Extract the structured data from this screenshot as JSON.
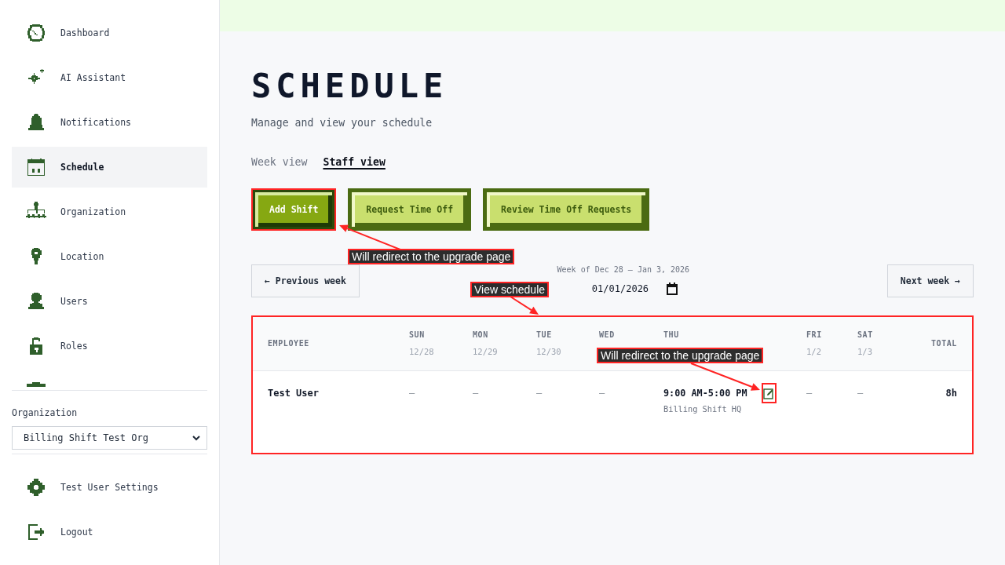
{
  "sidebar": {
    "nav_items": [
      {
        "label": "Dashboard",
        "selected": false
      },
      {
        "label": "AI Assistant",
        "selected": false
      },
      {
        "label": "Notifications",
        "selected": false
      },
      {
        "label": "Schedule",
        "selected": true
      },
      {
        "label": "Organization",
        "selected": false
      },
      {
        "label": "Location",
        "selected": false
      },
      {
        "label": "Users",
        "selected": false
      },
      {
        "label": "Roles",
        "selected": false
      }
    ],
    "organization": {
      "label": "Organization",
      "value": "Billing Shift Test Org"
    },
    "footer_items": [
      {
        "label": "Test User Settings"
      },
      {
        "label": "Logout"
      }
    ]
  },
  "header": {
    "title": "SCHEDULE",
    "subtitle": "Manage and view your schedule"
  },
  "view_tabs": [
    {
      "label": "Week view",
      "selected": false
    },
    {
      "label": "Staff view",
      "selected": true
    }
  ],
  "actions": [
    {
      "label": "Add Shift",
      "kind": "primary",
      "highlighted": true
    },
    {
      "label": "Request Time Off",
      "kind": "secondary",
      "highlighted": false
    },
    {
      "label": "Review Time Off Requests",
      "kind": "secondary",
      "highlighted": false
    }
  ],
  "week_nav": {
    "previous": "← Previous week",
    "caption": "Week of Dec 28 – Jan 3, 2026",
    "date": "01/01/2026",
    "next": "Next week →"
  },
  "table": {
    "highlighted": true,
    "columns": [
      {
        "kind": "employee",
        "label": "EMPLOYEE"
      },
      {
        "kind": "day",
        "label": "SUN",
        "date": "12/28"
      },
      {
        "kind": "day",
        "label": "MON",
        "date": "12/29"
      },
      {
        "kind": "day",
        "label": "TUE",
        "date": "12/30"
      },
      {
        "kind": "day",
        "label": "WED"
      },
      {
        "kind": "day",
        "label": "THU"
      },
      {
        "kind": "day",
        "label": "FRI",
        "date": "1/2"
      },
      {
        "kind": "day",
        "label": "SAT",
        "date": "1/3"
      },
      {
        "kind": "total",
        "label": "TOTAL"
      }
    ],
    "rows": [
      {
        "cells": [
          {
            "kind": "name",
            "text": "Test User"
          },
          {
            "kind": "empty",
            "text": "–"
          },
          {
            "kind": "empty",
            "text": "–"
          },
          {
            "kind": "empty",
            "text": "–"
          },
          {
            "kind": "empty",
            "text": "–"
          },
          {
            "kind": "shift",
            "time": "9:00 AM-5:00 PM",
            "location": "Billing Shift HQ",
            "edit_highlighted": true
          },
          {
            "kind": "empty",
            "text": "–"
          },
          {
            "kind": "empty",
            "text": "–"
          },
          {
            "kind": "total",
            "text": "8h"
          }
        ]
      }
    ]
  },
  "annotations": [
    {
      "kind": "action",
      "text": "Will redirect to the upgrade page"
    },
    {
      "kind": "table",
      "text": "View schedule"
    },
    {
      "kind": "edit",
      "text": "Will redirect to the upgrade page"
    }
  ]
}
